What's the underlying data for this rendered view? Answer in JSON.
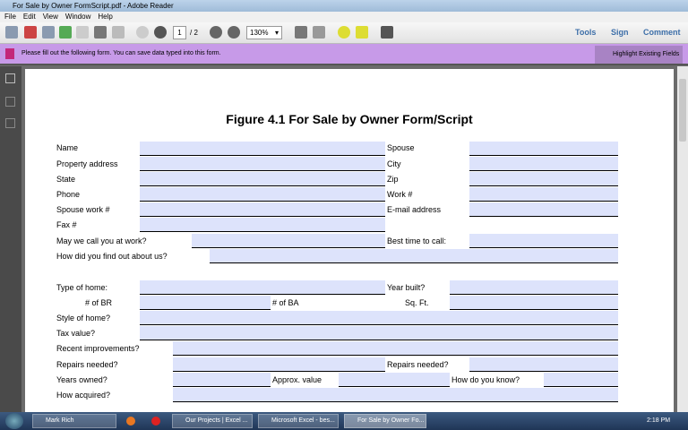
{
  "window": {
    "title": "For Sale by Owner FormScript.pdf - Adobe Reader"
  },
  "menu": [
    "File",
    "Edit",
    "View",
    "Window",
    "Help"
  ],
  "toolbar": {
    "page_current": "1",
    "page_total": "/ 2",
    "zoom": "130%",
    "tools": "Tools",
    "sign": "Sign",
    "comment": "Comment"
  },
  "notice": {
    "text": "Please fill out the following form. You can save data typed into this form.",
    "highlight": "Highlight Existing Fields"
  },
  "form": {
    "title": "Figure 4.1 For Sale by Owner Form/Script",
    "labels": [
      "Name",
      "Spouse",
      "Property address",
      "City",
      "State",
      "Zip",
      "Phone",
      "Work #",
      "Spouse work #",
      "E-mail address",
      "Fax #",
      "May we call you at work?",
      "Best time to call:",
      "How did you find out about us?",
      "Type of home:",
      "Year built?",
      "# of BR",
      "# of BA",
      "Sq. Ft.",
      "Style of home?",
      "Tax value?",
      "Recent improvements?",
      "Repairs needed?",
      "Repairs needed?",
      "Years owned?",
      "Approx. value",
      "How do you know?",
      "How acquired?"
    ]
  },
  "taskbar": {
    "items": [
      "Mark Rich",
      "Our Projects | Excel ...",
      "Microsoft Excel - bes...",
      "For Sale by Owner Fo..."
    ],
    "clock": "2:18 PM"
  }
}
